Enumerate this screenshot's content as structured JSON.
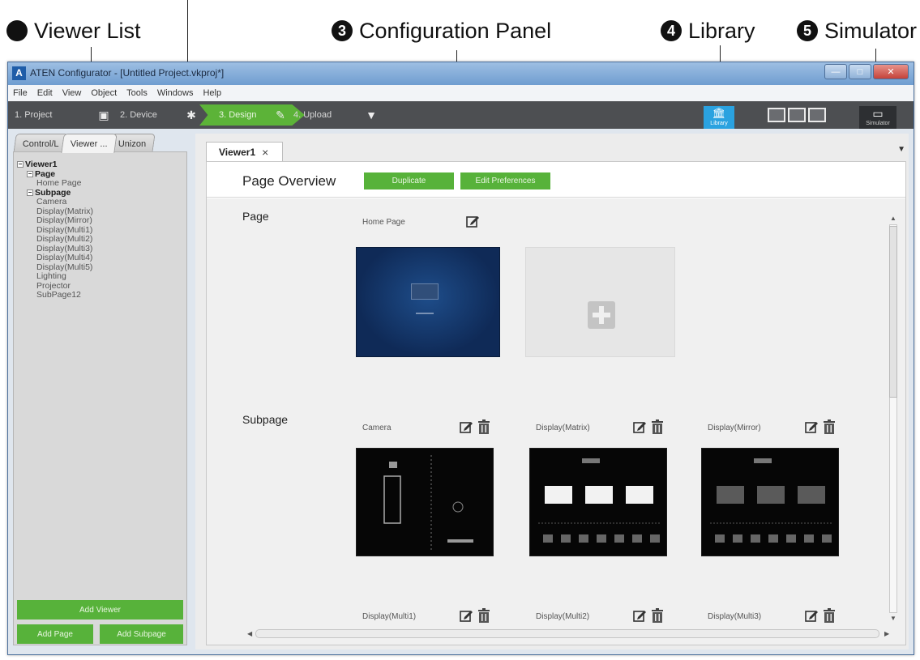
{
  "callouts": {
    "viewer_list": {
      "num": "",
      "label": "Viewer List"
    },
    "config_panel": {
      "num": "3",
      "label": "Configuration Panel"
    },
    "library": {
      "num": "4",
      "label": "Library"
    },
    "simulator": {
      "num": "5",
      "label": "Simulator"
    }
  },
  "window": {
    "title": "ATEN Configurator - [Untitled Project.vkproj*]",
    "menu": [
      "File",
      "Edit",
      "View",
      "Object",
      "Tools",
      "Windows",
      "Help"
    ]
  },
  "steps": [
    {
      "label": "1. Project"
    },
    {
      "label": "2. Device"
    },
    {
      "label": "3. Design",
      "active": true
    },
    {
      "label": "4. Upload"
    }
  ],
  "toolbar": {
    "library_label": "Library",
    "simulator_label": "Simulator"
  },
  "left_panel": {
    "tabs": [
      "Control/L",
      "Viewer ...",
      "Unizon"
    ],
    "tree": [
      {
        "label": "Viewer1",
        "level": 0,
        "bold": true,
        "toggle": "−"
      },
      {
        "label": "Page",
        "level": 1,
        "bold": true,
        "toggle": "−"
      },
      {
        "label": "Home Page",
        "level": 2
      },
      {
        "label": "Subpage",
        "level": 1,
        "bold": true,
        "toggle": "−"
      },
      {
        "label": "Camera",
        "level": 2
      },
      {
        "label": "Display(Matrix)",
        "level": 2
      },
      {
        "label": "Display(Mirror)",
        "level": 2
      },
      {
        "label": "Display(Multi1)",
        "level": 2
      },
      {
        "label": "Display(Multi2)",
        "level": 2
      },
      {
        "label": "Display(Multi3)",
        "level": 2
      },
      {
        "label": "Display(Multi4)",
        "level": 2
      },
      {
        "label": "Display(Multi5)",
        "level": 2
      },
      {
        "label": "Lighting",
        "level": 2
      },
      {
        "label": "Projector",
        "level": 2
      },
      {
        "label": "SubPage12",
        "level": 2
      }
    ],
    "buttons": {
      "add_viewer": "Add Viewer",
      "add_page": "Add Page",
      "add_subpage": "Add Subpage"
    }
  },
  "main": {
    "doc_tab": "Viewer1",
    "overview_title": "Page Overview",
    "duplicate_label": "Duplicate",
    "edit_prefs_label": "Edit Preferences",
    "page_section": "Page",
    "subpage_section": "Subpage",
    "pages": [
      {
        "label": "Home Page"
      }
    ],
    "subpages": [
      {
        "label": "Camera"
      },
      {
        "label": "Display(Matrix)"
      },
      {
        "label": "Display(Mirror)"
      },
      {
        "label": "Display(Multi1)"
      },
      {
        "label": "Display(Multi2)"
      },
      {
        "label": "Display(Multi3)"
      }
    ]
  },
  "icons": {
    "edit": "edit-icon",
    "trash": "trash-icon",
    "plus": "add-page-icon"
  },
  "colors": {
    "accent_green": "#57b23a",
    "library_blue": "#2aa2e0",
    "stepbar": "#4d4f52"
  }
}
